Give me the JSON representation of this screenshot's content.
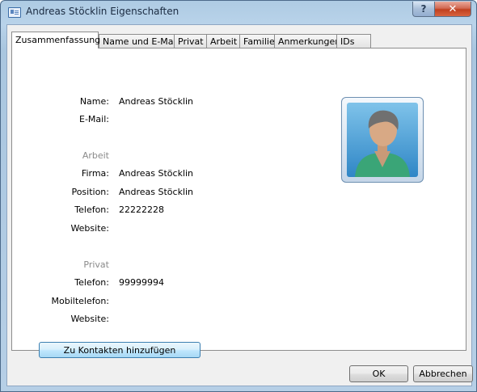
{
  "window": {
    "title": "Andreas Stöcklin Eigenschaften",
    "help_label": "?",
    "close_label": "✕"
  },
  "tabs": [
    "Zusammenfassung",
    "Name und E-Mail",
    "Privat",
    "Arbeit",
    "Familie",
    "Anmerkungen",
    "IDs"
  ],
  "summary": {
    "name_label": "Name:",
    "name_value": "Andreas Stöcklin",
    "email_label": "E-Mail:",
    "work_section": "Arbeit",
    "company_label": "Firma:",
    "company_value": "Andreas Stöcklin",
    "position_label": "Position:",
    "position_value": "Andreas Stöcklin",
    "work_phone_label": "Telefon:",
    "work_phone_value": "22222228",
    "work_website_label": "Website:",
    "private_section": "Privat",
    "home_phone_label": "Telefon:",
    "home_phone_value": "99999994",
    "mobile_label": "Mobiltelefon:",
    "home_website_label": "Website:",
    "add_contact_button": "Zu Kontakten hinzufügen"
  },
  "footer": {
    "ok_label": "OK",
    "cancel_label": "Abbrechen"
  },
  "icons": {
    "window": "contact-card-icon",
    "avatar": "person-silhouette-icon"
  },
  "colors": {
    "titlebar": "#b6cfe6",
    "close": "#c0401f",
    "section_label": "#8a8a8a",
    "add_button_border": "#3c7fb1"
  }
}
